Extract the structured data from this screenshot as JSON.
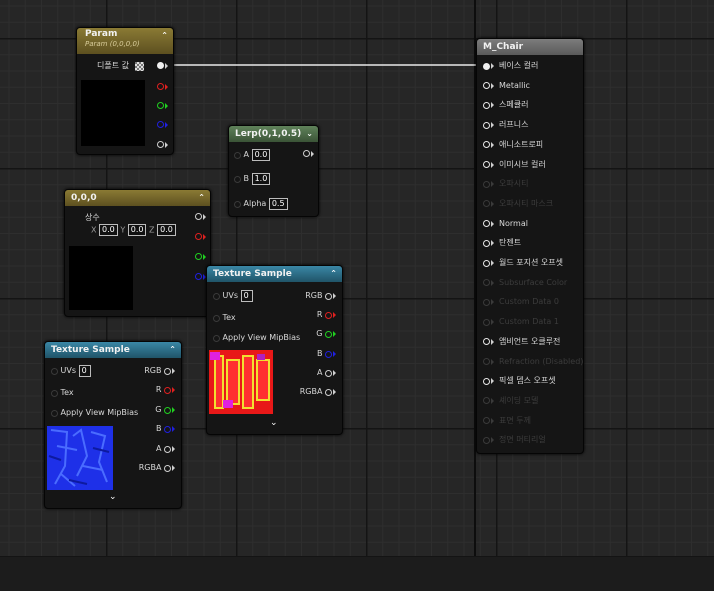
{
  "param_node": {
    "title": "Param",
    "subtitle": "Param (0,0,0,0)",
    "out_label": "디폴트 값"
  },
  "lerp_node": {
    "title": "Lerp(0,1,0.5)",
    "inputs": [
      {
        "label": "A",
        "value": "0.0"
      },
      {
        "label": "B",
        "value": "1.0"
      },
      {
        "label": "Alpha",
        "value": "0.5"
      }
    ]
  },
  "const_node": {
    "title": "0,0,0",
    "label": "상수",
    "x_label": "X",
    "x": "0.0",
    "y_label": "Y",
    "y": "0.0",
    "z_label": "Z",
    "z": "0.0"
  },
  "tex1": {
    "title": "Texture Sample",
    "uvs": "UVs",
    "uvs_value": "0",
    "tex": "Tex",
    "mip": "Apply View MipBias",
    "outputs": [
      "RGB",
      "R",
      "G",
      "B",
      "A",
      "RGBA"
    ]
  },
  "tex2": {
    "title": "Texture Sample",
    "uvs": "UVs",
    "uvs_value": "0",
    "tex": "Tex",
    "mip": "Apply View MipBias",
    "outputs": [
      "RGB",
      "R",
      "G",
      "B",
      "A",
      "RGBA"
    ]
  },
  "material": {
    "title": "M_Chair",
    "inputs": [
      {
        "label": "베이스 컬러",
        "active": true
      },
      {
        "label": "Metallic",
        "active": true
      },
      {
        "label": "스페큘러",
        "active": true
      },
      {
        "label": "러프니스",
        "active": true
      },
      {
        "label": "애니소트로피",
        "active": true
      },
      {
        "label": "이미시브 컬러",
        "active": true
      },
      {
        "label": "오파시티",
        "active": false
      },
      {
        "label": "오파시티 마스크",
        "active": false
      },
      {
        "label": "Normal",
        "active": true
      },
      {
        "label": "탄젠트",
        "active": true
      },
      {
        "label": "월드 포지션 오프셋",
        "active": true
      },
      {
        "label": "Subsurface Color",
        "active": false
      },
      {
        "label": "Custom Data 0",
        "active": false
      },
      {
        "label": "Custom Data 1",
        "active": false
      },
      {
        "label": "앰비언트 오클루전",
        "active": true
      },
      {
        "label": "Refraction (Disabled)",
        "active": false
      },
      {
        "label": "픽셀 뎁스 오프셋",
        "active": true
      },
      {
        "label": "셰이딩 모델",
        "active": false
      },
      {
        "label": "표면 두께",
        "active": false
      },
      {
        "label": "정면 머티리얼",
        "active": false
      }
    ]
  },
  "colors": {
    "param_header": "#7a6a2a",
    "lerp_header": "#4d6b48",
    "tex_header": "#2c6f8a",
    "material_header": "#6b6b6b"
  }
}
